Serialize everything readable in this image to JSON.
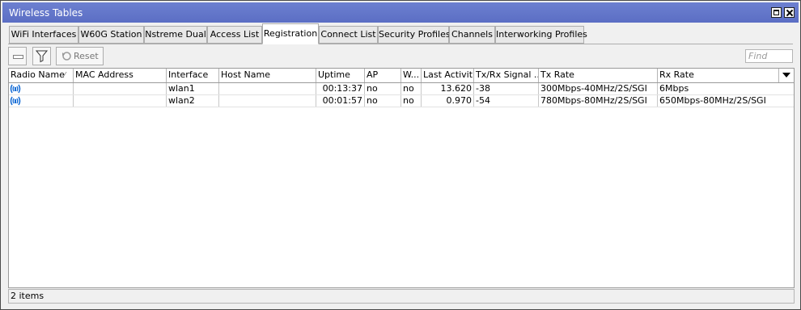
{
  "window": {
    "title": "Wireless Tables"
  },
  "tabs": [
    {
      "label": "WiFi Interfaces"
    },
    {
      "label": "W60G Station"
    },
    {
      "label": "Nstreme Dual"
    },
    {
      "label": "Access List"
    },
    {
      "label": "Registration",
      "active": true
    },
    {
      "label": "Connect List"
    },
    {
      "label": "Security Profiles"
    },
    {
      "label": "Channels"
    },
    {
      "label": "Interworking Profiles"
    }
  ],
  "toolbar": {
    "reset_label": "Reset",
    "find_placeholder": "Find"
  },
  "table": {
    "columns": [
      "Radio Name",
      "MAC Address",
      "Interface",
      "Host Name",
      "Uptime",
      "AP",
      "W...",
      "Last Activit...",
      "Tx/Rx Signal ...",
      "Tx Rate",
      "Rx Rate"
    ],
    "rows": [
      {
        "radio_name": "",
        "mac": "",
        "interface": "wlan1",
        "host": "",
        "uptime": "00:13:37",
        "ap": "no",
        "w": "no",
        "last_activity": "13.620",
        "signal": "-38",
        "tx_rate": "300Mbps-40MHz/2S/SGI",
        "rx_rate": "6Mbps"
      },
      {
        "radio_name": "",
        "mac": "",
        "interface": "wlan2",
        "host": "",
        "uptime": "00:01:57",
        "ap": "no",
        "w": "no",
        "last_activity": "0.970",
        "signal": "-54",
        "tx_rate": "780Mbps-80MHz/2S/SGI",
        "rx_rate": "650Mbps-80MHz/2S/SGI"
      }
    ]
  },
  "status": {
    "text": "2 items"
  },
  "icons": {
    "row_icon": "wireless-link-icon",
    "filter": "filter-funnel-icon",
    "reset": "reset-refresh-icon"
  },
  "colors": {
    "title_bar": "#5b6ec4",
    "row_icon": "#1a6fd6"
  }
}
